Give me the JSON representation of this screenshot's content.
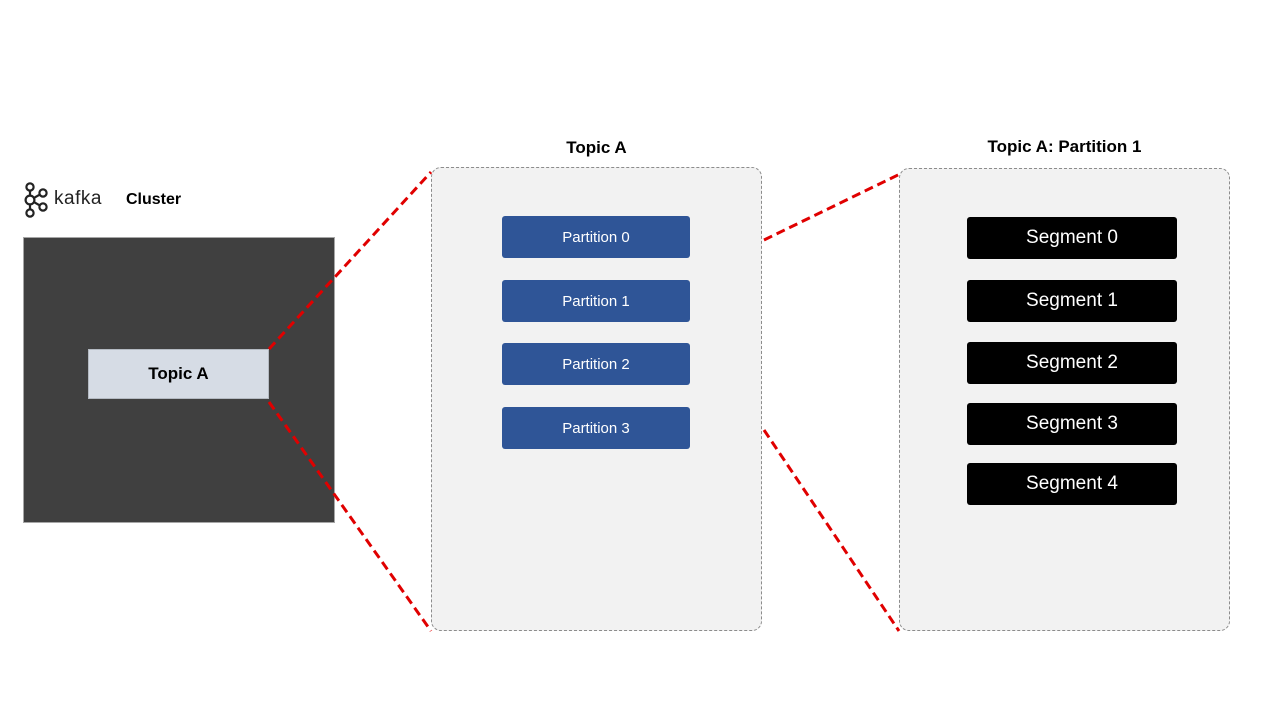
{
  "header": {
    "logo_icon": "kafka-logo-icon",
    "logo_text": "kafka",
    "cluster_label": "Cluster"
  },
  "cluster": {
    "topic_label": "Topic A"
  },
  "topic_panel": {
    "title": "Topic A",
    "partitions": [
      "Partition 0",
      "Partition 1",
      "Partition 2",
      "Partition 3"
    ]
  },
  "partition_panel": {
    "title": "Topic A: Partition 1",
    "segments": [
      "Segment 0",
      "Segment 1",
      "Segment 2",
      "Segment 3",
      "Segment 4"
    ]
  },
  "colors": {
    "cluster_bg": "#404040",
    "topic_block": "#d6dce5",
    "partition": "#2f5597",
    "segment": "#000000",
    "panel_bg": "#f2f2f2",
    "zoom_line": "#e00000"
  }
}
